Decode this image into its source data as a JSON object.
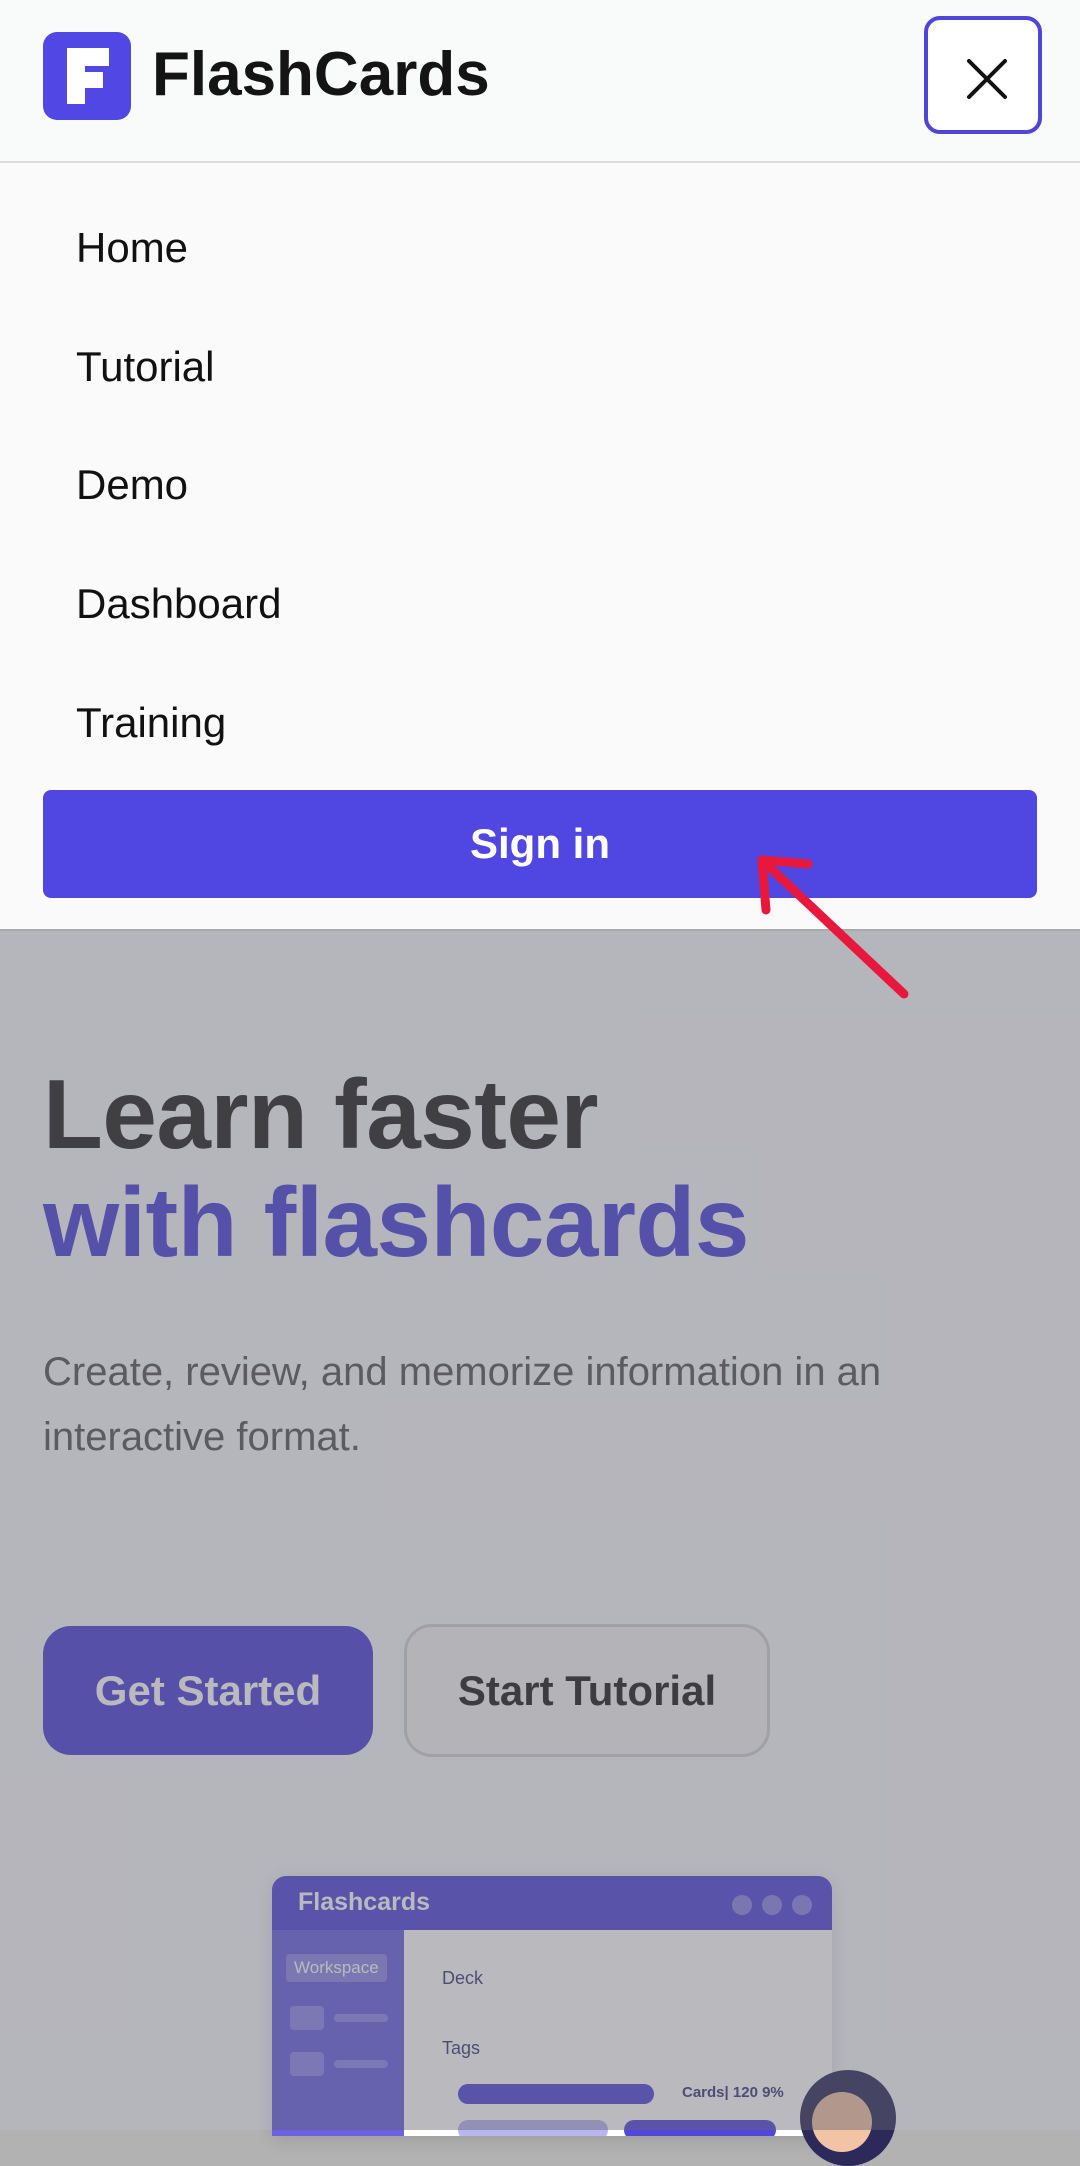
{
  "header": {
    "brand": "FlashCards",
    "logo_letter": "F"
  },
  "menu": {
    "items": [
      {
        "label": "Home"
      },
      {
        "label": "Tutorial"
      },
      {
        "label": "Demo"
      },
      {
        "label": "Dashboard"
      },
      {
        "label": "Training"
      }
    ],
    "signin_label": "Sign in"
  },
  "hero": {
    "title_line1": "Learn faster",
    "title_line2": "with flashcards",
    "subtitle": "Create, review, and memorize information in an interactive format.",
    "primary_button": "Get Started",
    "secondary_button": "Start Tutorial"
  },
  "mockup": {
    "title": "Flashcards",
    "workspace_label": "Workspace",
    "deck_label": "Deck",
    "tags_label": "Tags",
    "cards_label": "Cards| 120 9%"
  },
  "colors": {
    "accent": "#5047e3",
    "annotation_arrow": "#e8183c"
  },
  "icons": {
    "close": "close-icon",
    "logo": "flashcards-logo-icon",
    "annotation": "arrow-annotation-icon"
  }
}
